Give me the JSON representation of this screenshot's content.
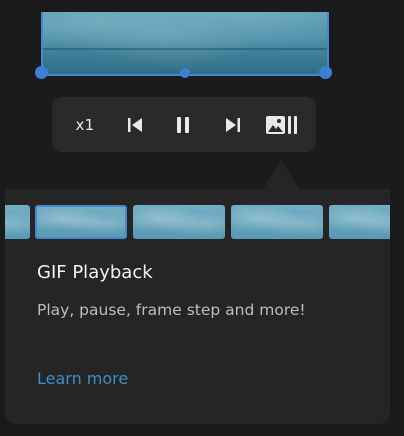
{
  "player": {
    "speed_label": "x1",
    "icons": {
      "previous": "skip-previous-icon",
      "pause": "pause-icon",
      "next": "skip-next-icon",
      "gallery": "image-gallery-icon"
    }
  },
  "card": {
    "title": "GIF Playback",
    "description": "Play, pause, frame step and more!",
    "learn_more": "Learn more"
  },
  "colors": {
    "accent": "#3c7fd4",
    "link": "#3a8ec8",
    "card_bg": "#252525",
    "controls_bg": "#2a2a2a"
  }
}
